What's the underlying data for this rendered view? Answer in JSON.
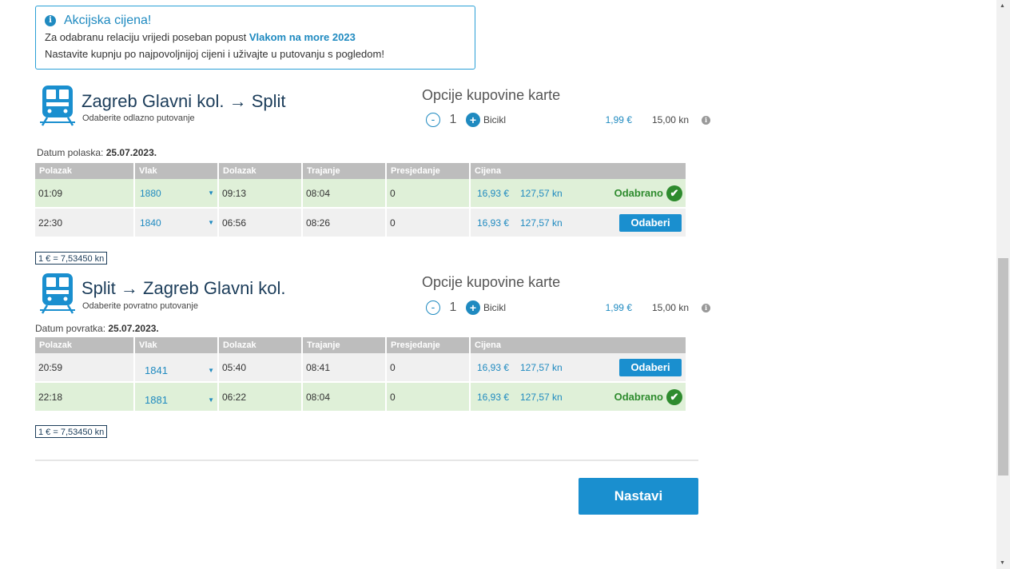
{
  "promo": {
    "title": "Akcijska cijena!",
    "line1_prefix": "Za odabranu relaciju vrijedi poseban popust ",
    "line1_highlight": "Vlakom na more 2023",
    "line2": "Nastavite kupnju po najpovoljnijoj cijeni i uživajte u putovanju s pogledom!"
  },
  "outbound": {
    "title": "Zagreb Glavni kol. → Split",
    "subtitle": "Odaberite odlazno putovanje",
    "options_title": "Opcije kupovine karte",
    "option": {
      "minus": "-",
      "qty": "1",
      "plus": "+",
      "name": "Bicikl",
      "eur": "1,99 €",
      "kn": "15,00 kn"
    },
    "date_label": "Datum polaska: ",
    "date": "25.07.2023.",
    "rate": "1 € = 7,53450 kn"
  },
  "return": {
    "title": "Split → Zagreb Glavni kol.",
    "subtitle": "Odaberite povratno putovanje",
    "options_title": "Opcije kupovine karte",
    "option": {
      "minus": "-",
      "qty": "1",
      "plus": "+",
      "name": "Bicikl",
      "eur": "1,99 €",
      "kn": "15,00 kn"
    },
    "date_label": "Datum povratka: ",
    "date": "25.07.2023.",
    "rate": "1 € = 7,53450 kn"
  },
  "columns": [
    "Polazak",
    "Vlak",
    "Dolazak",
    "Trajanje",
    "Presjedanje",
    "Cijena"
  ],
  "outbound_rows": [
    {
      "dep": "01:09",
      "train": "1880",
      "arr": "09:13",
      "dur": "08:04",
      "transfer": "0",
      "eur": "16,93 €",
      "kn": "127,57 kn",
      "action": "Odabrano"
    },
    {
      "dep": "22:30",
      "train": "1840",
      "arr": "06:56",
      "dur": "08:26",
      "transfer": "0",
      "eur": "16,93 €",
      "kn": "127,57 kn",
      "action": "Odaberi"
    }
  ],
  "return_rows": [
    {
      "dep": "20:59",
      "train": "1841",
      "arr": "05:40",
      "dur": "08:41",
      "transfer": "0",
      "eur": "16,93 €",
      "kn": "127,57 kn",
      "action": "Odaberi"
    },
    {
      "dep": "22:18",
      "train": "1881",
      "arr": "06:22",
      "dur": "08:04",
      "transfer": "0",
      "eur": "16,93 €",
      "kn": "127,57 kn",
      "action": "Odabrano"
    }
  ],
  "continue_label": "Nastavi",
  "icons": {
    "info": "info-icon",
    "train": "train-icon",
    "check": "check-icon",
    "caret": "caret-down-icon"
  },
  "colors": {
    "accent": "#1a8fcf",
    "selected_row": "#dff0d8",
    "success": "#2e8b2e",
    "header": "#bdbdbd"
  }
}
